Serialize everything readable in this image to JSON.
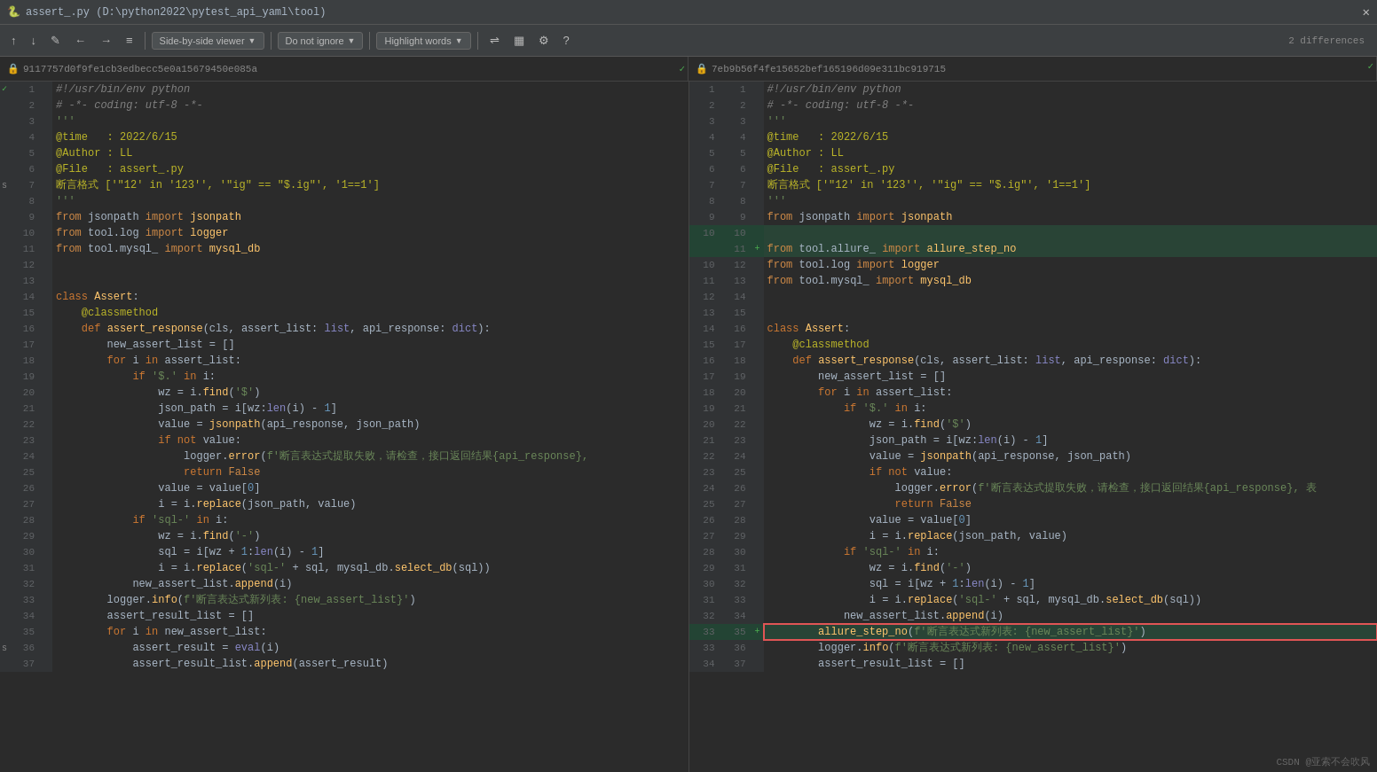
{
  "titleBar": {
    "icon": "🐍",
    "title": "assert_.py (D:\\python2022\\pytest_api_yaml\\tool)",
    "closeLabel": "✕"
  },
  "toolbar": {
    "upBtn": "↑",
    "downBtn": "↓",
    "editBtn": "✎",
    "backBtn": "←",
    "forwardBtn": "→",
    "menuBtn": "≡",
    "viewerDropdown": "Side-by-side viewer",
    "ignoreDropdown": "Do not ignore",
    "highlightDropdown": "Highlight words",
    "syncBtn": "⇌",
    "collapseBtn": "▦",
    "settingsBtn": "⚙",
    "helpBtn": "?"
  },
  "diffInfo": {
    "leftHash": "9117757d0f9fe1cb3edbecc5e0a15679450e085a",
    "rightHash": "7eb9b56f4fe15652bef165196d09e311bc919715",
    "differences": "2 differences"
  },
  "watermark": "CSDN @亚索不会吹风",
  "leftLines": [
    {
      "num": 1,
      "marker": "",
      "text": "#!/usr/bin/env python",
      "type": "cmt"
    },
    {
      "num": 2,
      "marker": "",
      "text": "# -*- coding: utf-8 -*-",
      "type": "cmt"
    },
    {
      "num": 3,
      "marker": "",
      "text": "'''",
      "type": "str"
    },
    {
      "num": 4,
      "marker": "",
      "text": "@time   : 2022/6/15",
      "type": "dec"
    },
    {
      "num": 5,
      "marker": "",
      "text": "@Author : LL",
      "type": "dec"
    },
    {
      "num": 6,
      "marker": "",
      "text": "@File   : assert_.py",
      "type": "dec"
    },
    {
      "num": 7,
      "marker": "s",
      "text": "断言格式 ['\"12' in '123'', '\"ig\" == \"$.ig\"', '1==1']",
      "type": "dec"
    },
    {
      "num": 8,
      "marker": "",
      "text": "'''",
      "type": "str"
    },
    {
      "num": 9,
      "marker": "",
      "text": "from jsonpath import jsonpath",
      "type": "normal"
    },
    {
      "num": 10,
      "marker": "",
      "text": "from tool.log import logger",
      "type": "normal"
    },
    {
      "num": 11,
      "marker": "",
      "text": "from tool.mysql_ import mysql_db",
      "type": "normal"
    },
    {
      "num": 12,
      "marker": "",
      "text": "",
      "type": "normal"
    },
    {
      "num": 13,
      "marker": "",
      "text": "",
      "type": "normal"
    },
    {
      "num": 14,
      "marker": "",
      "text": "class Assert:",
      "type": "normal"
    },
    {
      "num": 15,
      "marker": "",
      "text": "    @classmethod",
      "type": "normal"
    },
    {
      "num": 16,
      "marker": "",
      "text": "    def assert_response(cls, assert_list: list, api_response: dict):",
      "type": "normal"
    },
    {
      "num": 17,
      "marker": "",
      "text": "        new_assert_list = []",
      "type": "normal"
    },
    {
      "num": 18,
      "marker": "",
      "text": "        for i in assert_list:",
      "type": "normal"
    },
    {
      "num": 19,
      "marker": "",
      "text": "            if '$.' in i:",
      "type": "normal"
    },
    {
      "num": 20,
      "marker": "",
      "text": "                wz = i.find('$')",
      "type": "normal"
    },
    {
      "num": 21,
      "marker": "",
      "text": "                json_path = i[wz:len(i) - 1]",
      "type": "normal"
    },
    {
      "num": 22,
      "marker": "",
      "text": "                value = jsonpath(api_response, json_path)",
      "type": "normal"
    },
    {
      "num": 23,
      "marker": "",
      "text": "                if not value:",
      "type": "normal"
    },
    {
      "num": 24,
      "marker": "",
      "text": "                    logger.error(f'断言表达式提取失败，请检查，接口返回结果{api_response},",
      "type": "normal"
    },
    {
      "num": 25,
      "marker": "",
      "text": "                    return False",
      "type": "normal"
    },
    {
      "num": 26,
      "marker": "",
      "text": "                value = value[0]",
      "type": "normal"
    },
    {
      "num": 27,
      "marker": "",
      "text": "                i = i.replace(json_path, value)",
      "type": "normal"
    },
    {
      "num": 28,
      "marker": "",
      "text": "            if 'sql-' in i:",
      "type": "normal"
    },
    {
      "num": 29,
      "marker": "",
      "text": "                wz = i.find('-')",
      "type": "normal"
    },
    {
      "num": 30,
      "marker": "",
      "text": "                sql = i[wz + 1:len(i) - 1]",
      "type": "normal"
    },
    {
      "num": 31,
      "marker": "",
      "text": "                i = i.replace('sql-' + sql, mysql_db.select_db(sql))",
      "type": "normal"
    },
    {
      "num": 32,
      "marker": "",
      "text": "            new_assert_list.append(i)",
      "type": "normal"
    },
    {
      "num": 33,
      "marker": "",
      "text": "        logger.info(f'断言表达式新列表: {new_assert_list}')",
      "type": "normal"
    },
    {
      "num": 34,
      "marker": "",
      "text": "        assert_result_list = []",
      "type": "normal"
    },
    {
      "num": 35,
      "marker": "",
      "text": "        for i in new_assert_list:",
      "type": "normal"
    },
    {
      "num": 36,
      "marker": "",
      "text": "            assert_result = eval(i)",
      "type": "normal"
    },
    {
      "num": 37,
      "marker": "",
      "text": "            assert_result_list.append(assert_result)",
      "type": "normal"
    }
  ],
  "rightLines": [
    {
      "num": 1,
      "marker": "",
      "text": "#!/usr/bin/env python",
      "type": "cmt"
    },
    {
      "num": 2,
      "marker": "",
      "text": "# -*- coding: utf-8 -*-",
      "type": "cmt"
    },
    {
      "num": 3,
      "marker": "",
      "text": "'''",
      "type": "str"
    },
    {
      "num": 4,
      "marker": "",
      "text": "@time   : 2022/6/15",
      "type": "dec"
    },
    {
      "num": 5,
      "marker": "",
      "text": "@Author : LL",
      "type": "dec"
    },
    {
      "num": 6,
      "marker": "",
      "text": "@File   : assert_.py",
      "type": "dec"
    },
    {
      "num": 7,
      "marker": "",
      "text": "断言格式 ['\"12' in '123'', '\"ig\" == \"$.ig\"', '1==1']",
      "type": "dec"
    },
    {
      "num": 8,
      "marker": "",
      "text": "'''",
      "type": "str"
    },
    {
      "num": 9,
      "marker": "",
      "text": "from jsonpath import jsonpath",
      "type": "normal"
    },
    {
      "num": 10,
      "marker": "",
      "text": "",
      "type": "changed"
    },
    {
      "num": 11,
      "marker": "",
      "text": "from tool.allure_ import allure_step_no",
      "type": "added"
    },
    {
      "num": 12,
      "marker": "",
      "text": "from tool.log import logger",
      "type": "normal"
    },
    {
      "num": 13,
      "marker": "",
      "text": "from tool.mysql_ import mysql_db",
      "type": "normal"
    },
    {
      "num": 14,
      "marker": "",
      "text": "",
      "type": "normal"
    },
    {
      "num": 15,
      "marker": "",
      "text": "",
      "type": "normal"
    },
    {
      "num": 16,
      "marker": "",
      "text": "class Assert:",
      "type": "normal"
    },
    {
      "num": 17,
      "marker": "",
      "text": "    @classmethod",
      "type": "normal"
    },
    {
      "num": 18,
      "marker": "",
      "text": "    def assert_response(cls, assert_list: list, api_response: dict):",
      "type": "normal"
    },
    {
      "num": 19,
      "marker": "",
      "text": "        new_assert_list = []",
      "type": "normal"
    },
    {
      "num": 20,
      "marker": "",
      "text": "        for i in assert_list:",
      "type": "normal"
    },
    {
      "num": 21,
      "marker": "",
      "text": "            if '$.' in i:",
      "type": "normal"
    },
    {
      "num": 22,
      "marker": "",
      "text": "                wz = i.find('$')",
      "type": "normal"
    },
    {
      "num": 23,
      "marker": "",
      "text": "                json_path = i[wz:len(i) - 1]",
      "type": "normal"
    },
    {
      "num": 24,
      "marker": "",
      "text": "                value = jsonpath(api_response, json_path)",
      "type": "normal"
    },
    {
      "num": 25,
      "marker": "",
      "text": "                if not value:",
      "type": "normal"
    },
    {
      "num": 26,
      "marker": "",
      "text": "                    logger.error(f'断言表达式提取失败，请检查，接口返回结果{api_response}, 表",
      "type": "normal"
    },
    {
      "num": 27,
      "marker": "",
      "text": "                    return False",
      "type": "normal"
    },
    {
      "num": 28,
      "marker": "",
      "text": "                value = value[0]",
      "type": "normal"
    },
    {
      "num": 29,
      "marker": "",
      "text": "                i = i.replace(json_path, value)",
      "type": "normal"
    },
    {
      "num": 30,
      "marker": "",
      "text": "            if 'sql-' in i:",
      "type": "normal"
    },
    {
      "num": 31,
      "marker": "",
      "text": "                wz = i.find('-')",
      "type": "normal"
    },
    {
      "num": 32,
      "marker": "",
      "text": "                sql = i[wz + 1:len(i) - 1]",
      "type": "normal"
    },
    {
      "num": 33,
      "marker": "",
      "text": "                i = i.replace('sql-' + sql, mysql_db.select_db(sql))",
      "type": "normal"
    },
    {
      "num": 34,
      "marker": "",
      "text": "            new_assert_list.append(i)",
      "type": "normal"
    },
    {
      "num": 35,
      "marker": "",
      "text": "        allure_step_no(f'断言表达式新列表: {new_assert_list}')",
      "type": "added_highlight"
    },
    {
      "num": 36,
      "marker": "",
      "text": "        logger.info(f'断言表达式新列表: {new_assert_list}')",
      "type": "normal"
    },
    {
      "num": 37,
      "marker": "",
      "text": "        assert_result_list = []",
      "type": "normal"
    }
  ]
}
